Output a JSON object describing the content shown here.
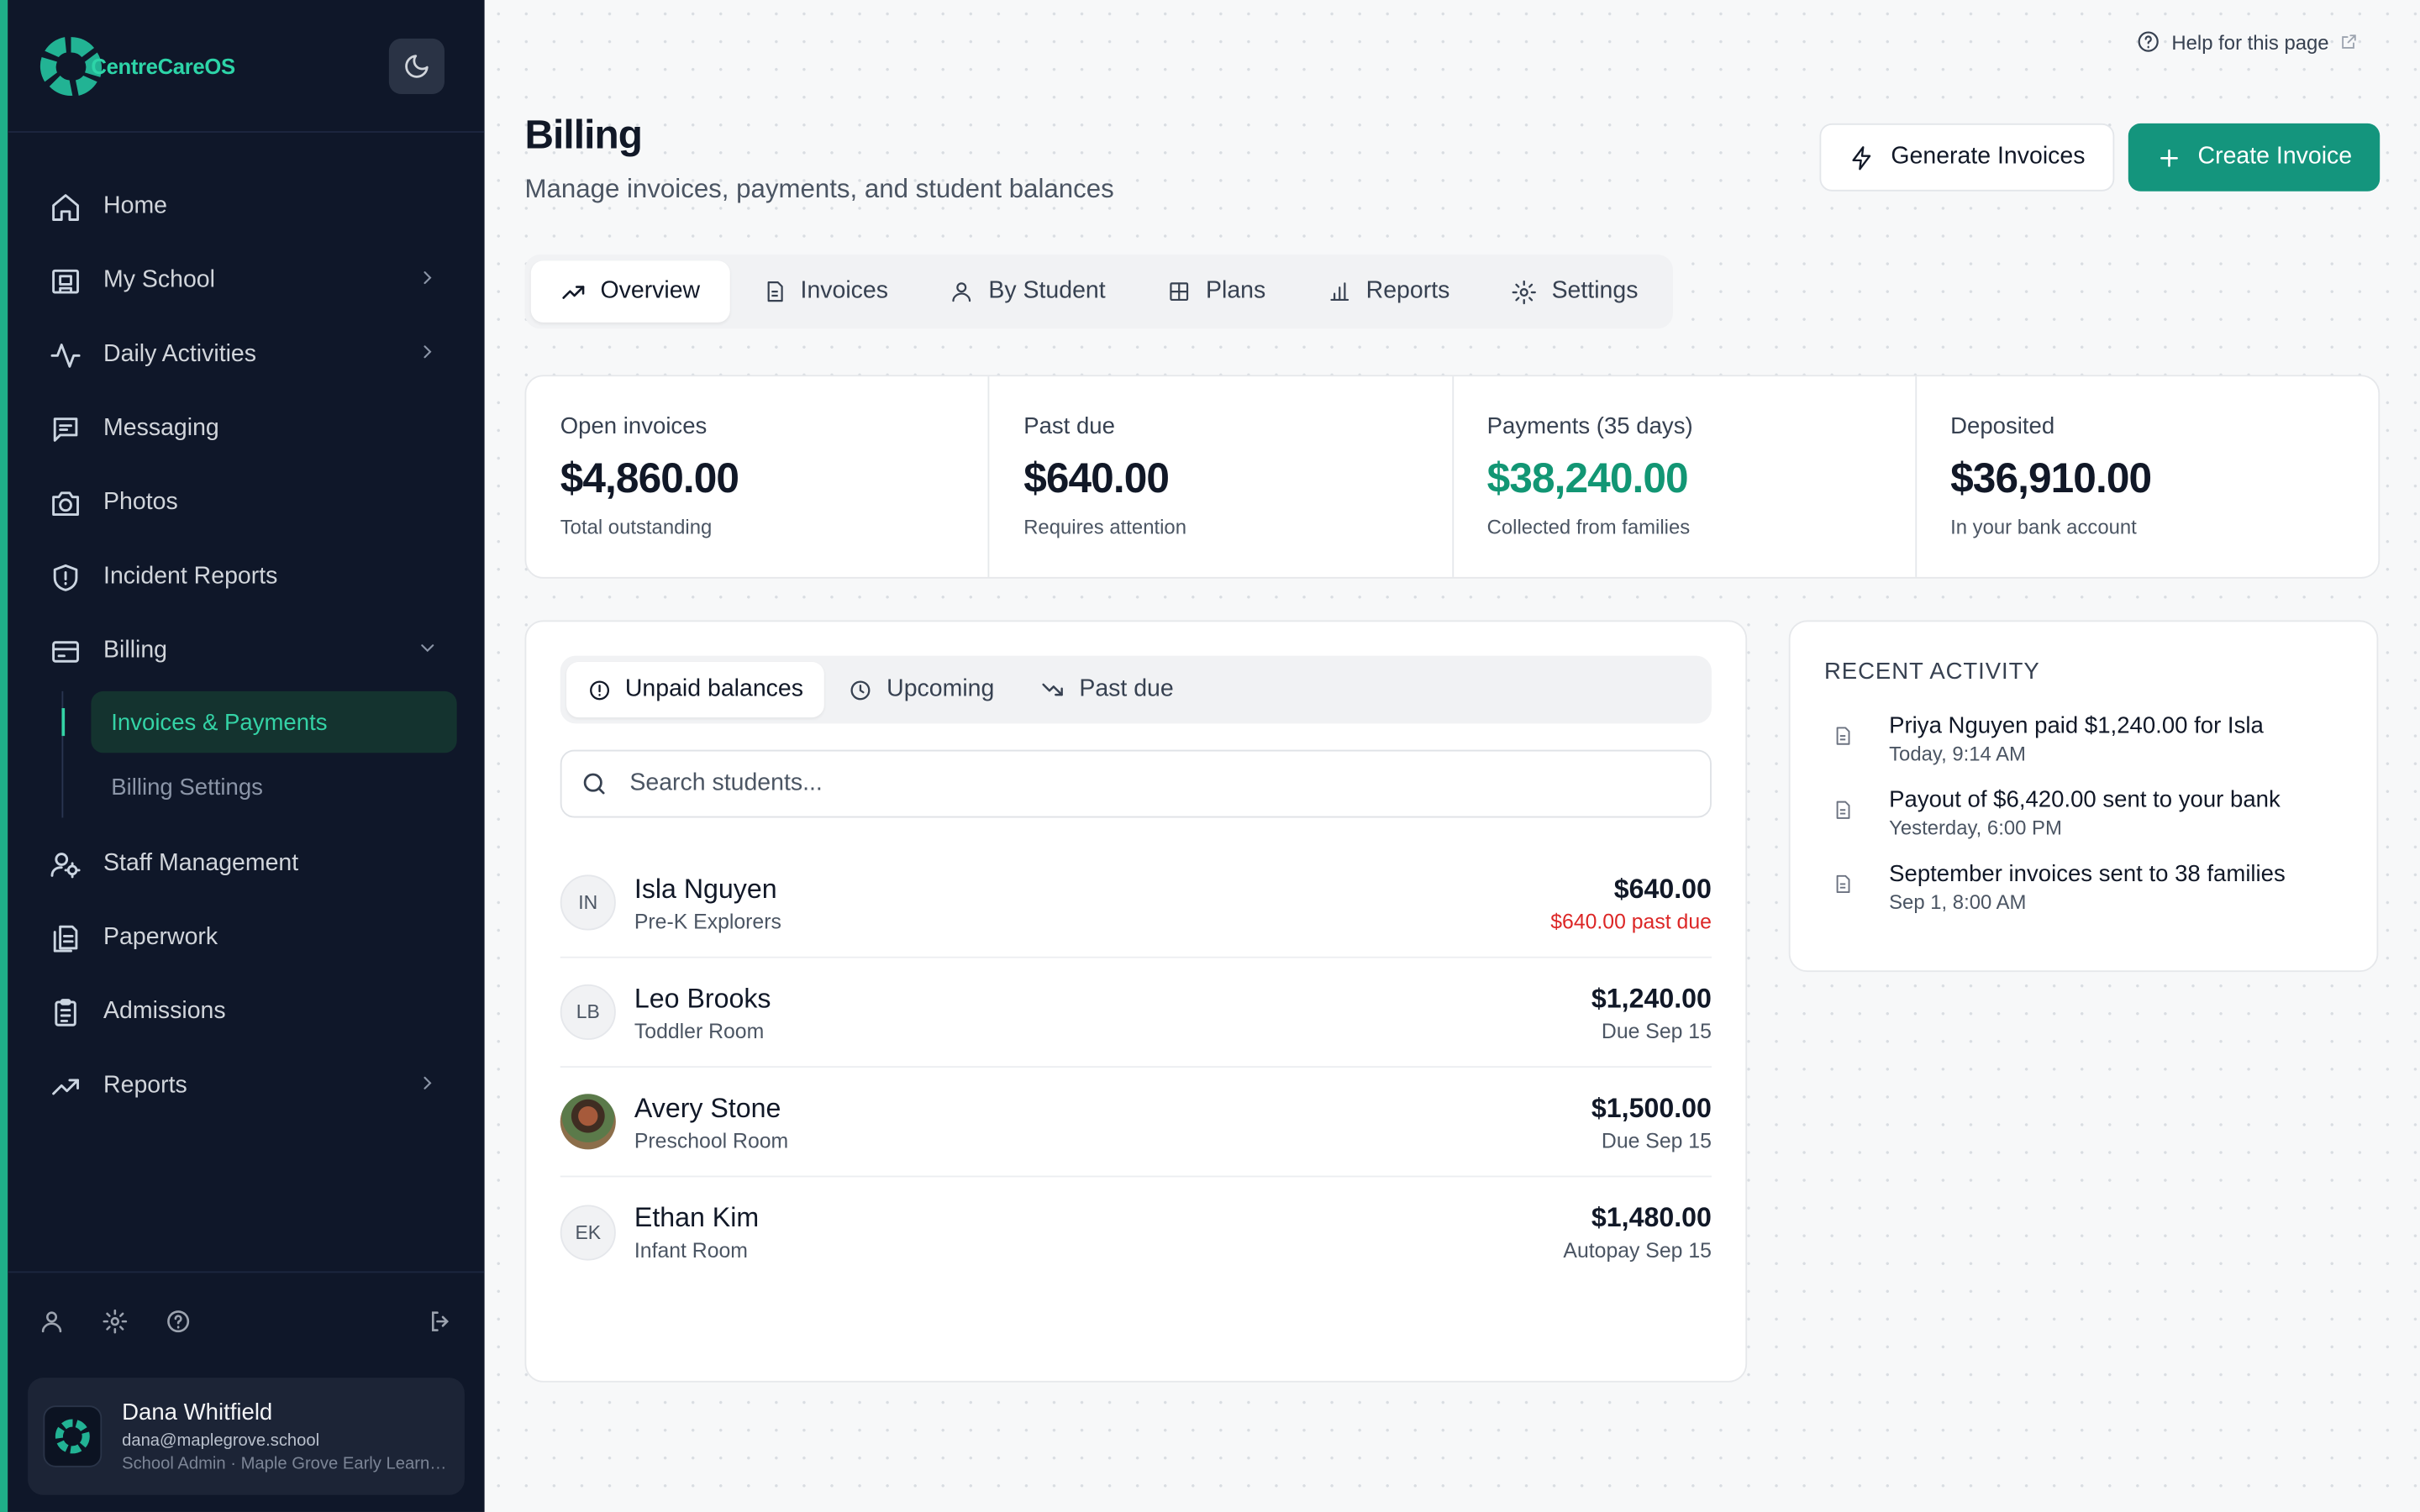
{
  "brand": {
    "name": "CentreCareOS",
    "accent": "#1fae88"
  },
  "sidebar": {
    "items": [
      {
        "label": "Home",
        "icon": "home-icon"
      },
      {
        "label": "My School",
        "icon": "school-icon",
        "has_children": true
      },
      {
        "label": "Daily Activities",
        "icon": "activity-icon",
        "has_children": true
      },
      {
        "label": "Messaging",
        "icon": "message-icon"
      },
      {
        "label": "Photos",
        "icon": "camera-icon"
      },
      {
        "label": "Incident Reports",
        "icon": "shield-icon"
      },
      {
        "label": "Billing",
        "icon": "billing-icon",
        "expanded": true
      },
      {
        "label": "Staff Management",
        "icon": "staff-icon"
      },
      {
        "label": "Paperwork",
        "icon": "paperwork-icon"
      },
      {
        "label": "Admissions",
        "icon": "clipboard-icon"
      },
      {
        "label": "Reports",
        "icon": "trend-icon",
        "has_children": true
      }
    ],
    "billing_sub": [
      {
        "label": "Invoices & Payments",
        "active": true
      },
      {
        "label": "Billing Settings"
      }
    ],
    "user": {
      "name": "Dana Whitfield",
      "email": "dana@maplegrove.school",
      "role": "School Admin · Maple Grove Early Learning"
    }
  },
  "header": {
    "help_label": "Help for this page",
    "title": "Billing",
    "subtitle": "Manage invoices, payments, and student balances",
    "generate_label": "Generate Invoices",
    "create_label": "Create Invoice"
  },
  "tabs": [
    {
      "label": "Overview",
      "active": true
    },
    {
      "label": "Invoices"
    },
    {
      "label": "By Student"
    },
    {
      "label": "Plans"
    },
    {
      "label": "Reports"
    },
    {
      "label": "Settings"
    }
  ],
  "stats": [
    {
      "label": "Open invoices",
      "value": "$4,860.00",
      "note": "Total outstanding"
    },
    {
      "label": "Past due",
      "value": "$640.00",
      "note": "Requires attention"
    },
    {
      "label": "Payments (35 days)",
      "value": "$38,240.00",
      "note": "Collected from families",
      "color": "#129674"
    },
    {
      "label": "Deposited",
      "value": "$36,910.00",
      "note": "In your bank account"
    }
  ],
  "balances": {
    "segments": [
      {
        "label": "Unpaid balances",
        "active": true
      },
      {
        "label": "Upcoming"
      },
      {
        "label": "Past due"
      }
    ],
    "search_placeholder": "Search students...",
    "rows": [
      {
        "initials": "IN",
        "name": "Isla Nguyen",
        "room": "Pre-K Explorers",
        "amount": "$640.00",
        "note": "$640.00 past due",
        "past_due": true
      },
      {
        "initials": "LB",
        "name": "Leo Brooks",
        "room": "Toddler Room",
        "amount": "$1,240.00",
        "note": "Due Sep 15"
      },
      {
        "initials": "",
        "name": "Avery Stone",
        "room": "Preschool Room",
        "amount": "$1,500.00",
        "note": "Due Sep 15",
        "photo": true
      },
      {
        "initials": "EK",
        "name": "Ethan Kim",
        "room": "Infant Room",
        "amount": "$1,480.00",
        "note": "Autopay Sep 15"
      }
    ]
  },
  "activity": {
    "title": "RECENT ACTIVITY",
    "items": [
      {
        "text": "Priya Nguyen paid $1,240.00 for Isla",
        "time": "Today, 9:14 AM"
      },
      {
        "text": "Payout of $6,420.00 sent to your bank",
        "time": "Yesterday, 6:00 PM"
      },
      {
        "text": "September invoices sent to 38 families",
        "time": "Sep 1, 8:00 AM"
      }
    ]
  }
}
